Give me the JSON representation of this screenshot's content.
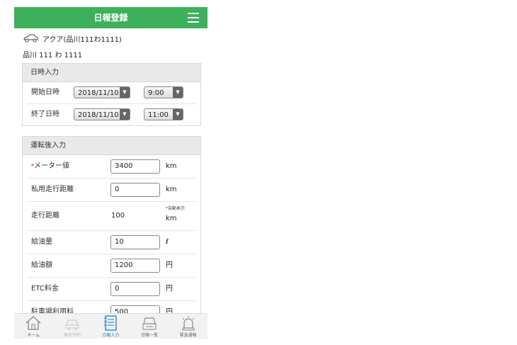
{
  "header": {
    "title": "日報登録",
    "menu_icon": "hamburger-icon"
  },
  "vehicle": {
    "name": "アクア(品川111わ1111)",
    "plate": "品川 111 わ 1111",
    "icon": "car-icon"
  },
  "datetime_section": {
    "title": "日時入力",
    "rows": [
      {
        "label": "開始日時",
        "date": "2018/11/10",
        "time": "9:00"
      },
      {
        "label": "終了日時",
        "date": "2018/11/10",
        "time": "11:00"
      }
    ]
  },
  "after_drive_section": {
    "title": "運転後入力",
    "meter": {
      "required_mark": "*",
      "label": "メーター値",
      "value": "3400",
      "unit": "km"
    },
    "private_distance": {
      "label": "私用走行距離",
      "value": "0",
      "unit": "km"
    },
    "distance": {
      "label": "走行距離",
      "value": "100",
      "note": "*自動表示",
      "unit": "km"
    },
    "fuel_amount": {
      "label": "給油量",
      "value": "10",
      "unit": "ℓ"
    },
    "fuel_cost": {
      "label": "給油額",
      "value": "1200",
      "unit": "円"
    },
    "etc_fee": {
      "label": "ETC料金",
      "value": "0",
      "unit": "円"
    },
    "parking_fee": {
      "label": "駐車場利用料",
      "value": "500",
      "unit": "円"
    }
  },
  "tabs": [
    {
      "label": "ホーム",
      "icon": "home-icon"
    },
    {
      "label": "車両予約",
      "icon": "car-reserve-icon"
    },
    {
      "label": "日報入力",
      "icon": "notebook-icon"
    },
    {
      "label": "日報一覧",
      "icon": "report-list-icon"
    },
    {
      "label": "緊急通報",
      "icon": "alarm-icon"
    }
  ],
  "colors": {
    "header": "#3cb05a",
    "active_tab": "#2d7fc1",
    "required": "#d0021b"
  }
}
